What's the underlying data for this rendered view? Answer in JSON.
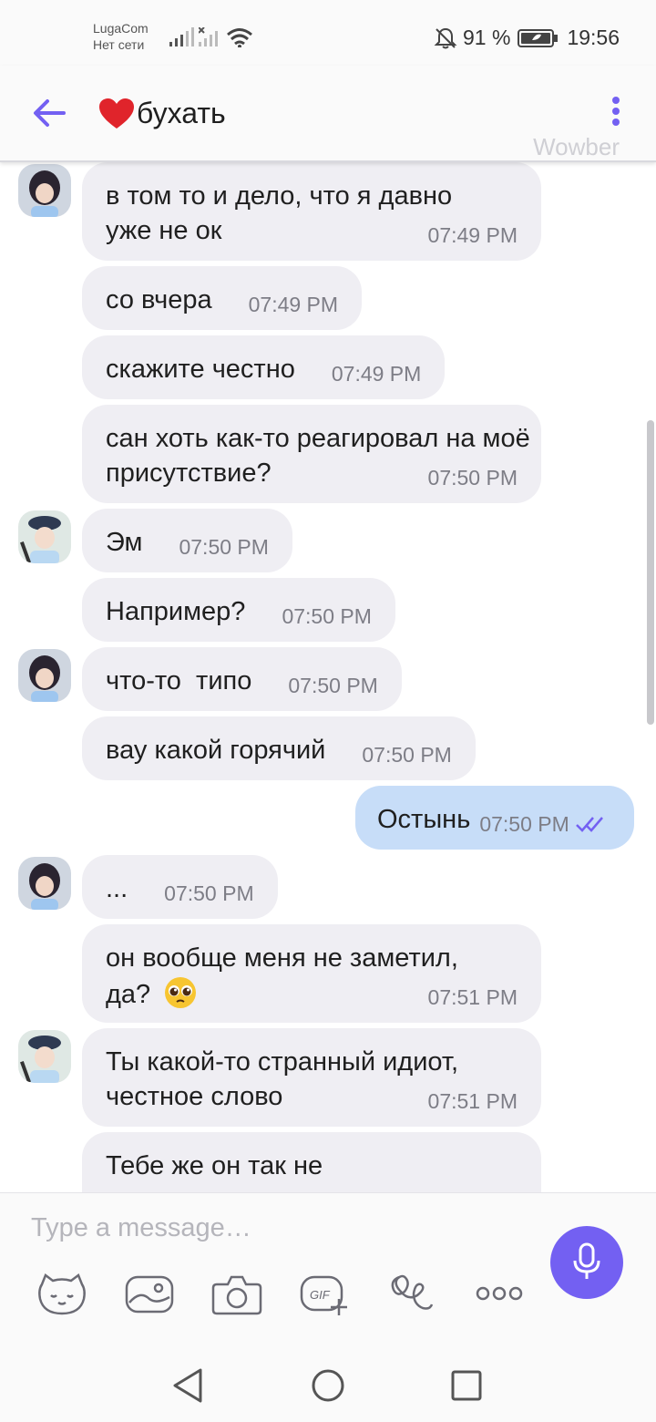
{
  "status_bar": {
    "carrier_name": "LugaCom",
    "network_status": "Нет сети",
    "battery": "91 %",
    "time": "19:56"
  },
  "header": {
    "title": "бухать",
    "watermark": "Wowber"
  },
  "messages": [
    {
      "text": "в том то и дело, что я давно уже не ок",
      "time": "07:49 PM",
      "direction": "in",
      "sender": "user-a"
    },
    {
      "text": "со вчера",
      "time": "07:49 PM",
      "direction": "in",
      "sender": "user-a"
    },
    {
      "text": "скажите честно",
      "time": "07:49 PM",
      "direction": "in",
      "sender": "user-a"
    },
    {
      "text": "сан хоть как-то реагировал на моё присутствие?",
      "time": "07:50 PM",
      "direction": "in",
      "sender": "user-a"
    },
    {
      "text": "Эм",
      "time": "07:50 PM",
      "direction": "in",
      "sender": "user-b"
    },
    {
      "text": "Например?",
      "time": "07:50 PM",
      "direction": "in",
      "sender": "user-b"
    },
    {
      "text": "что-то  типо",
      "time": "07:50 PM",
      "direction": "in",
      "sender": "user-a"
    },
    {
      "text": "вау какой горячий",
      "time": "07:50 PM",
      "direction": "in",
      "sender": "user-a"
    },
    {
      "text": "Остынь",
      "time": "07:50 PM",
      "direction": "out",
      "sender": "me"
    },
    {
      "text": "...",
      "time": "07:50 PM",
      "direction": "in",
      "sender": "user-a"
    },
    {
      "text": "он вообще меня не заметил, да?",
      "time": "07:51 PM",
      "direction": "in",
      "sender": "user-a"
    },
    {
      "text": "Ты какой-то странный идиот, честное слово",
      "time": "07:51 PM",
      "direction": "in",
      "sender": "user-b"
    },
    {
      "text": "Тебе же он так не",
      "time": "",
      "direction": "in",
      "sender": "user-b"
    }
  ],
  "composer": {
    "placeholder": "Type a message…",
    "tools": [
      "sticker-icon",
      "gallery-icon",
      "camera-icon",
      "gif-icon",
      "doodle-icon",
      "more-icon"
    ],
    "send_icon": "microphone-icon"
  },
  "colors": {
    "accent": "#7360f2",
    "incoming_bubble": "#efeef3",
    "outgoing_bubble": "#c7ddf8",
    "read_receipt": "#7360f2"
  }
}
